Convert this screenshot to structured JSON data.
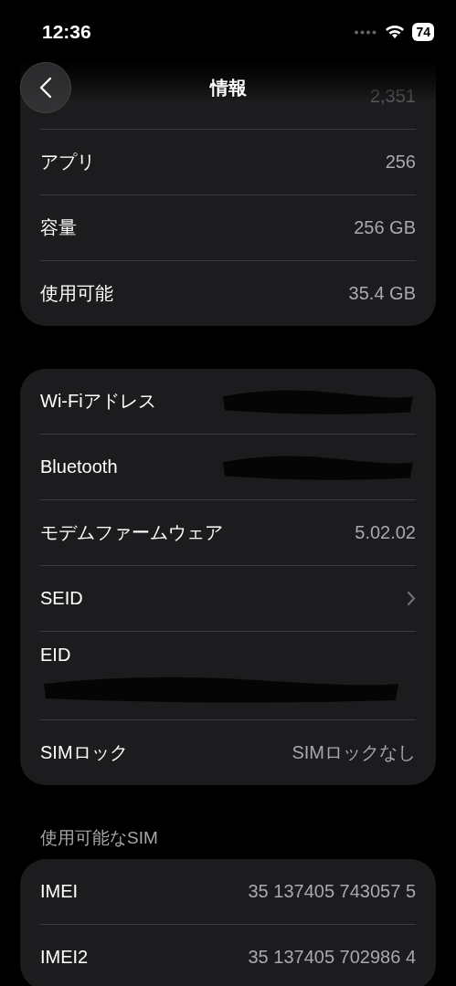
{
  "status_bar": {
    "time": "12:36",
    "battery": "74"
  },
  "nav": {
    "title": "情報"
  },
  "sections": [
    {
      "rows": [
        {
          "kind": "faded",
          "value": "2,351"
        },
        {
          "kind": "value",
          "label": "アプリ",
          "value": "256"
        },
        {
          "kind": "value",
          "label": "容量",
          "value": "256 GB"
        },
        {
          "kind": "value",
          "label": "使用可能",
          "value": "35.4 GB"
        }
      ]
    },
    {
      "rows": [
        {
          "kind": "redacted",
          "label": "Wi-Fiアドレス"
        },
        {
          "kind": "redacted",
          "label": "Bluetooth"
        },
        {
          "kind": "value",
          "label": "モデムファームウェア",
          "value": "5.02.02"
        },
        {
          "kind": "chevron",
          "label": "SEID"
        },
        {
          "kind": "redacted_below",
          "label": "EID"
        },
        {
          "kind": "value",
          "label": "SIMロック",
          "value": "SIMロックなし"
        }
      ]
    },
    {
      "header": "使用可能なSIM",
      "rows": [
        {
          "kind": "value",
          "label": "IMEI",
          "value": "35 137405 743057 5"
        },
        {
          "kind": "value",
          "label": "IMEI2",
          "value": "35 137405 702986 4"
        }
      ]
    }
  ]
}
